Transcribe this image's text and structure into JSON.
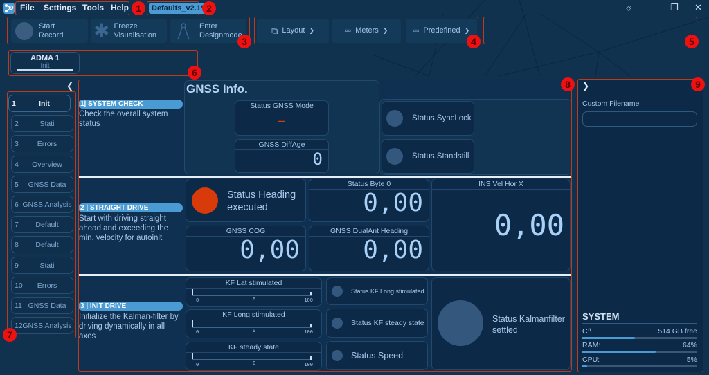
{
  "menubar": {
    "items": [
      "File",
      "Settings",
      "Tools",
      "Help"
    ],
    "preset": "Defaults_v2.1*",
    "window_controls": [
      "settings-icon",
      "minimize-icon",
      "restore-icon",
      "close-icon"
    ]
  },
  "toolbar": {
    "record": {
      "line1": "Start",
      "line2": "Record",
      "icon": "record-circle-icon"
    },
    "freeze": {
      "line1": "Freeze",
      "line2": "Visualisation",
      "icon": "snowflake-icon"
    },
    "design": {
      "line1": "Enter",
      "line2": "Designmode",
      "icon": "compass-icon"
    },
    "layout": {
      "label": "Layout",
      "icon": "layout-icon"
    },
    "meters": {
      "label": "Meters",
      "icon": "meters-grid-icon"
    },
    "predefined": {
      "label": "Predefined",
      "icon": "predefined-grid-icon"
    }
  },
  "device_tab": {
    "name": "ADMA 1",
    "sub": "Init"
  },
  "sidebar": {
    "items": [
      {
        "num": "1",
        "label": "Init",
        "active": true
      },
      {
        "num": "2",
        "label": "Stati"
      },
      {
        "num": "3",
        "label": "Errors"
      },
      {
        "num": "4",
        "label": "Overview"
      },
      {
        "num": "5",
        "label": "GNSS Data"
      },
      {
        "num": "6",
        "label": "GNSS Analysis"
      },
      {
        "num": "7",
        "label": "Default"
      },
      {
        "num": "8",
        "label": "Default"
      },
      {
        "num": "9",
        "label": "Stati"
      },
      {
        "num": "10",
        "label": "Errors"
      },
      {
        "num": "11",
        "label": "GNSS Data"
      },
      {
        "num": "12",
        "label": "GNSS Analysis"
      }
    ]
  },
  "steps": [
    {
      "title": "1|  SYSTEM CHECK",
      "desc": "Check the overall system status"
    },
    {
      "title": "2 |  STRAIGHT DRIVE",
      "desc": "Start with driving straight ahead and exceeding the min. velocity for autoinit"
    },
    {
      "title": "3 |  INIT DRIVE",
      "desc": "Initialize the Kalman-filter by driving dynamically in all axes"
    }
  ],
  "gnss_info": {
    "title": "GNSS Info.",
    "mode": {
      "label": "Status GNSS Mode",
      "value": "–"
    },
    "diffage": {
      "label": "GNSS DiffAge",
      "value": "0"
    }
  },
  "status_leds": {
    "synclock": "Status SyncLock",
    "standstill": "Status Standstill",
    "heading": "Status Heading executed",
    "kf_long": "Status KF Long stimulated",
    "kf_steady": "Status KF steady state",
    "speed": "Status Speed",
    "kf_settled": "Status Kalmanfilter settled"
  },
  "meters": {
    "status_byte": {
      "label": "Status Byte 0",
      "value": "0,00"
    },
    "ins_vel": {
      "label": "INS Vel Hor X",
      "value": "0,00"
    },
    "gnss_cog": {
      "label": "GNSS COG",
      "value": "0,00"
    },
    "dualant": {
      "label": "GNSS DualAnt Heading",
      "value": "0,00"
    }
  },
  "sliders": [
    {
      "label": "KF Lat stimulated",
      "min": "0",
      "value": "0",
      "max": "100"
    },
    {
      "label": "KF Long stimulated",
      "min": "0",
      "value": "0",
      "max": "100"
    },
    {
      "label": "KF steady state",
      "min": "0",
      "value": "0",
      "max": "100"
    }
  ],
  "right_panel": {
    "filename_label": "Custom Filename",
    "filename_value": "",
    "system_title": "SYSTEM",
    "disk": {
      "label": "C:\\",
      "value": "514 GB free",
      "fraction": 0.46
    },
    "ram": {
      "label": "RAM:",
      "value": "64%",
      "fraction": 0.64
    },
    "cpu": {
      "label": "CPU:",
      "value": "5%",
      "fraction": 0.05
    }
  },
  "colors": {
    "background": "#10324f",
    "panel": "#0c2a48",
    "accent": "#4a9bd4",
    "led_off": "#34587d",
    "led_on": "#d93a0a",
    "annotation": "#c0391b"
  },
  "annotations": [
    "1",
    "2",
    "3",
    "4",
    "5",
    "6",
    "7",
    "8",
    "9"
  ]
}
